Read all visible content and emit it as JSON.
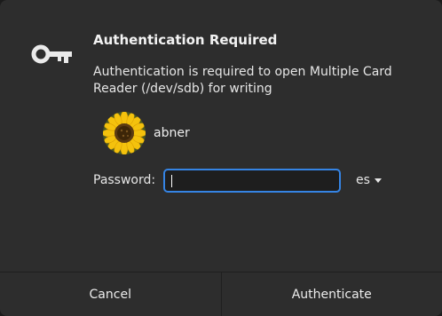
{
  "dialog": {
    "title": "Authentication Required",
    "message": "Authentication is required to open Multiple Card Reader (/dev/sdb) for writing",
    "icon": "key-icon"
  },
  "user": {
    "name": "abner",
    "avatar": "sunflower-avatar"
  },
  "password": {
    "label": "Password:",
    "value": ""
  },
  "keyboard_layout": {
    "label": "es"
  },
  "buttons": {
    "cancel": "Cancel",
    "authenticate": "Authenticate"
  },
  "colors": {
    "accent": "#3584e4",
    "background": "#2d2d2d"
  }
}
